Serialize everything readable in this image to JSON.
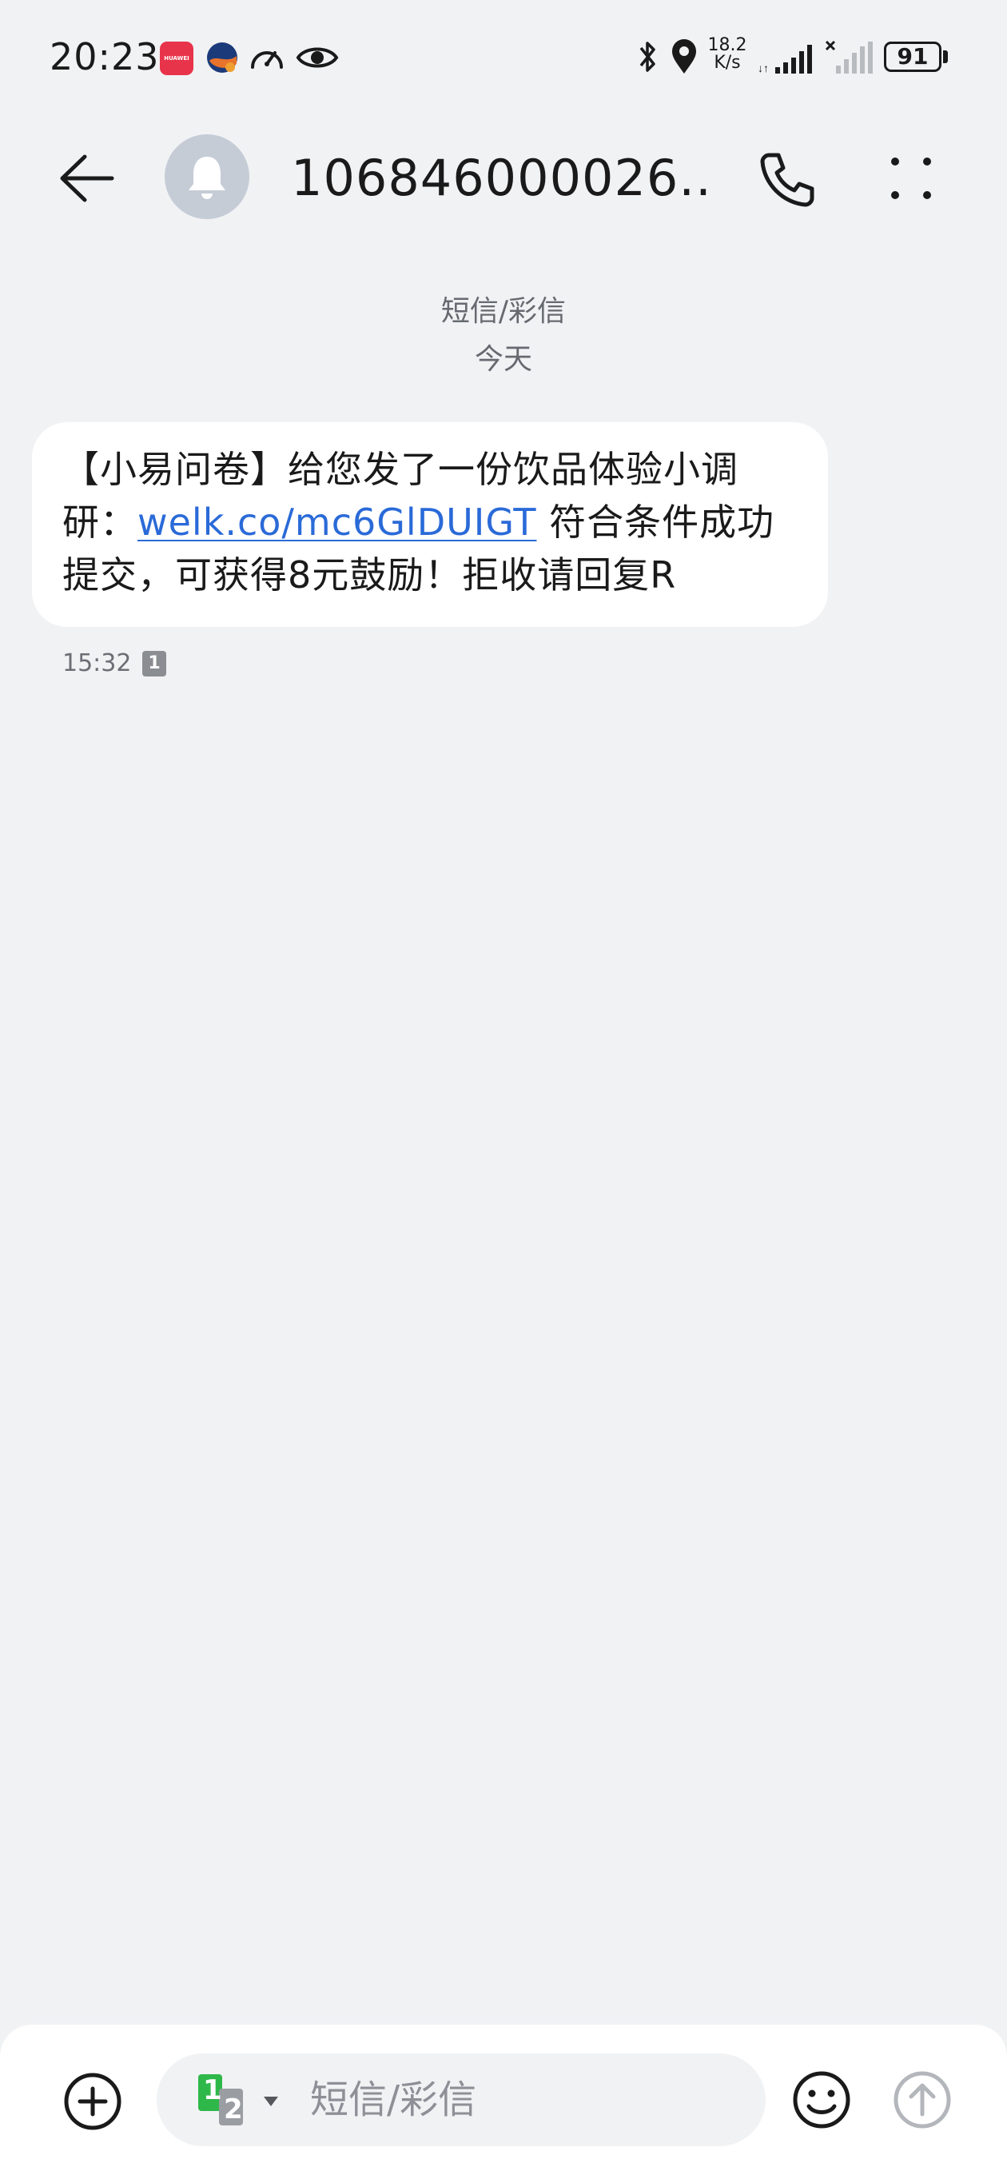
{
  "status_bar": {
    "time": "20:23",
    "net_speed_value": "18.2",
    "net_speed_unit": "K/s",
    "battery": "91",
    "app_badge": "HUAWEI"
  },
  "header": {
    "contact": "106846000026..."
  },
  "thread": {
    "type_label": "短信/彩信",
    "date_label": "今天"
  },
  "message": {
    "text_before_link": "【小易问卷】给您发了一份饮品体验小调研：",
    "link": "welk.co/mc6GlDUIGT",
    "text_after_link": " 符合条件成功提交，可获得8元鼓励！拒收请回复R",
    "time": "15:32",
    "sim": "1"
  },
  "composer": {
    "placeholder": "短信/彩信",
    "sim_primary": "1",
    "sim_secondary": "2"
  },
  "colors": {
    "background": "#f1f2f4",
    "bubble": "#ffffff",
    "link": "#2a6ad8",
    "sim_green": "#2fb84a"
  }
}
